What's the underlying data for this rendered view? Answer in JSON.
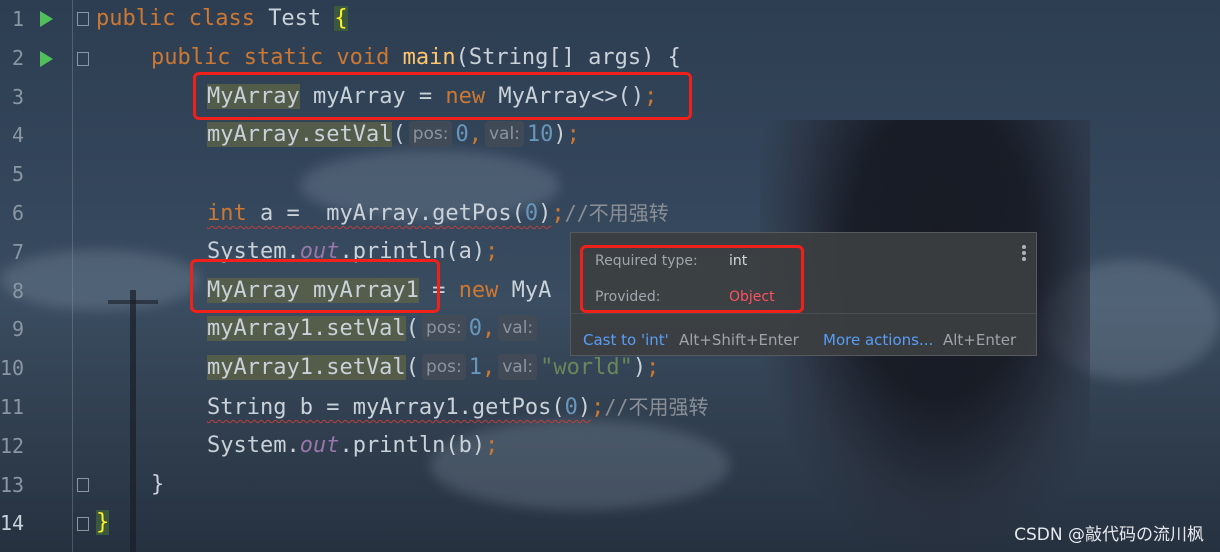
{
  "gutter": {
    "line_numbers": [
      "1",
      "2",
      "3",
      "4",
      "5",
      "6",
      "7",
      "8",
      "9",
      "10",
      "11",
      "12",
      "13",
      "14"
    ]
  },
  "code": {
    "l1": {
      "kw": "public class ",
      "name": "Test ",
      "brace": "{"
    },
    "l2": {
      "kw": "public static void ",
      "fn": "main",
      "rest": "(String[] args) {"
    },
    "l3": {
      "type": "MyArray",
      "var": " myArray = ",
      "kw": "new",
      "rest": " MyArray<>()",
      "semi": ";"
    },
    "l4": {
      "call": "myArray.setVal",
      "open": "(",
      "hint1": "pos:",
      "n1": "0",
      "comma": ",",
      "hint2": "val:",
      "n2": "10",
      "close": ")",
      "semi": ";"
    },
    "l6": {
      "kw": "int",
      "rest": " a =  myArray.getPos(",
      "n": "0",
      "close": ")",
      "semi": ";",
      "comment": "//不用强转"
    },
    "l7": {
      "a": "System.",
      "static": "out",
      "b": ".println(a)",
      "semi": ";"
    },
    "l8": {
      "type": "MyArray",
      "var": " myArray1",
      "eq": " = ",
      "kw": "new",
      "rest": " MyA"
    },
    "l9": {
      "call": "myArray1.setVal",
      "open": "(",
      "hint1": "pos:",
      "n1": "0",
      "comma": ",",
      "hint2": "val:"
    },
    "l10": {
      "call": "myArray1.setVal",
      "open": "(",
      "hint1": "pos:",
      "n1": "1",
      "comma": ",",
      "hint2": "val:",
      "str": "\"world\"",
      "close": ")",
      "semi": ";"
    },
    "l11": {
      "a": "String b = myArray1.getPos(",
      "n": "0",
      "close": ")",
      "semi": ";",
      "comment": "//不用强转"
    },
    "l12": {
      "a": "System.",
      "static": "out",
      "b": ".println(b)",
      "semi": ";"
    },
    "l13": {
      "brace": "}"
    },
    "l14": {
      "brace": "}"
    }
  },
  "popup": {
    "required_label": "Required type:",
    "required_value": "int",
    "provided_label": "Provided:",
    "provided_value": "Object",
    "action1": "Cast to 'int'",
    "action1_shortcut": "Alt+Shift+Enter",
    "action2": "More actions...",
    "action2_shortcut": "Alt+Enter"
  },
  "colors": {
    "keyword": "#cc7832",
    "function": "#ffc66d",
    "number": "#6897bb",
    "string": "#6a8759",
    "static_field": "#9876aa",
    "error_text": "#ff5261",
    "link": "#589df6",
    "highlight_box": "#f0201a"
  },
  "watermark": "CSDN @敲代码の流川枫"
}
